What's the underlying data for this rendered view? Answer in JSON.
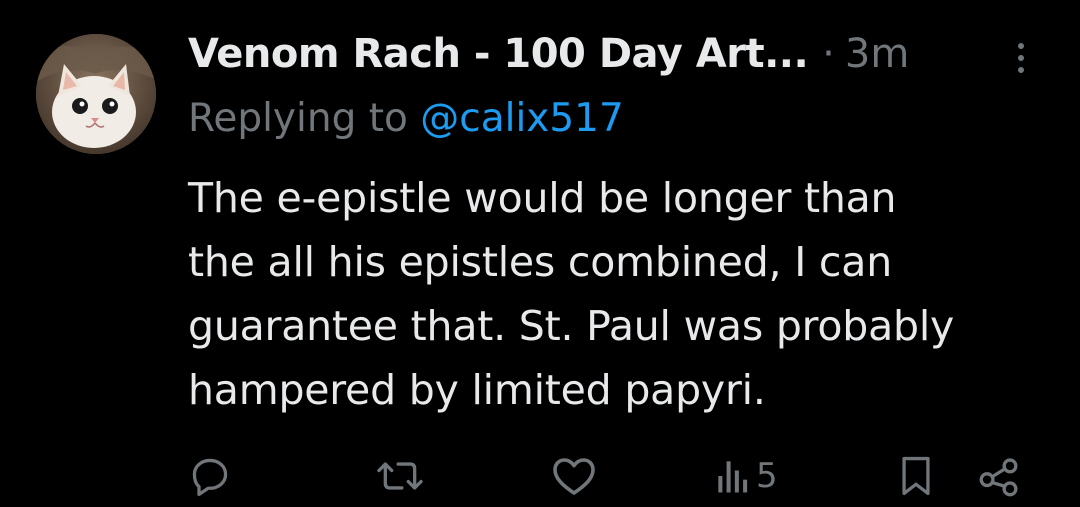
{
  "tweet": {
    "display_name": "Venom Rach - 100 Day Art...",
    "separator": "·",
    "timestamp": "3m",
    "reply_prefix": "Replying to",
    "reply_handle": "@calix517",
    "body_lines": [
      "The e-epistle would be longer than",
      "the all his epistles combined, I can",
      "guarantee that. St. Paul was probably",
      "hampered by limited papyri."
    ]
  },
  "actions": {
    "reply_icon": "reply-icon",
    "retweet_icon": "retweet-icon",
    "like_icon": "heart-icon",
    "views_icon": "views-bar-chart-icon",
    "views_count": "5",
    "bookmark_icon": "bookmark-icon",
    "share_icon": "share-icon"
  },
  "colors": {
    "background": "#000000",
    "primary_text": "#e7e9ea",
    "secondary_text": "#71767b",
    "link": "#1d9bf0"
  }
}
